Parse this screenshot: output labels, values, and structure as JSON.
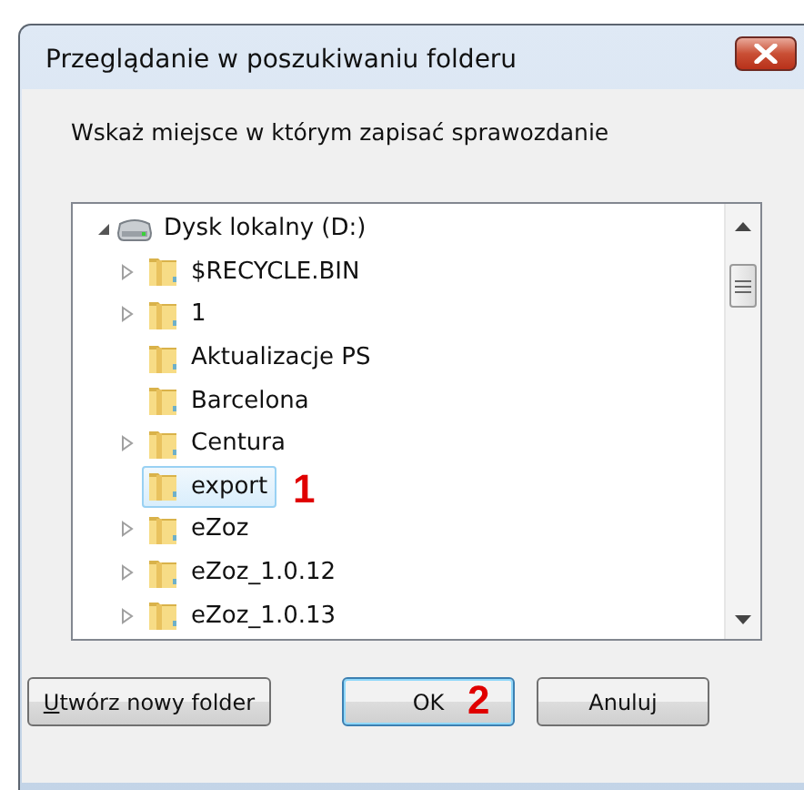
{
  "window": {
    "title": "Przeglądanie w poszukiwaniu folderu"
  },
  "prompt": "Wskaż miejsce w którym zapisać sprawozdanie",
  "tree": {
    "label": "Dysk lokalny (D:)",
    "expanded": true,
    "children": [
      {
        "label": "$RECYCLE.BIN",
        "has_children": true,
        "selected": false
      },
      {
        "label": "1",
        "has_children": true,
        "selected": false
      },
      {
        "label": "Aktualizacje PS",
        "has_children": false,
        "selected": false
      },
      {
        "label": "Barcelona",
        "has_children": false,
        "selected": false
      },
      {
        "label": "Centura",
        "has_children": true,
        "selected": false
      },
      {
        "label": "export",
        "has_children": false,
        "selected": true,
        "annotation": "1"
      },
      {
        "label": "eZoz",
        "has_children": true,
        "selected": false
      },
      {
        "label": "eZoz_1.0.12",
        "has_children": true,
        "selected": false
      },
      {
        "label": "eZoz_1.0.13",
        "has_children": true,
        "selected": false
      }
    ]
  },
  "buttons": [
    {
      "label": "Utwórz nowy folder",
      "kind": "new-folder",
      "mnemonic_first": true,
      "default": false
    },
    {
      "label": "OK",
      "kind": "ok",
      "mnemonic_first": false,
      "default": true,
      "annotation": "2"
    },
    {
      "label": "Anuluj",
      "kind": "cancel",
      "mnemonic_first": false,
      "default": false
    }
  ]
}
